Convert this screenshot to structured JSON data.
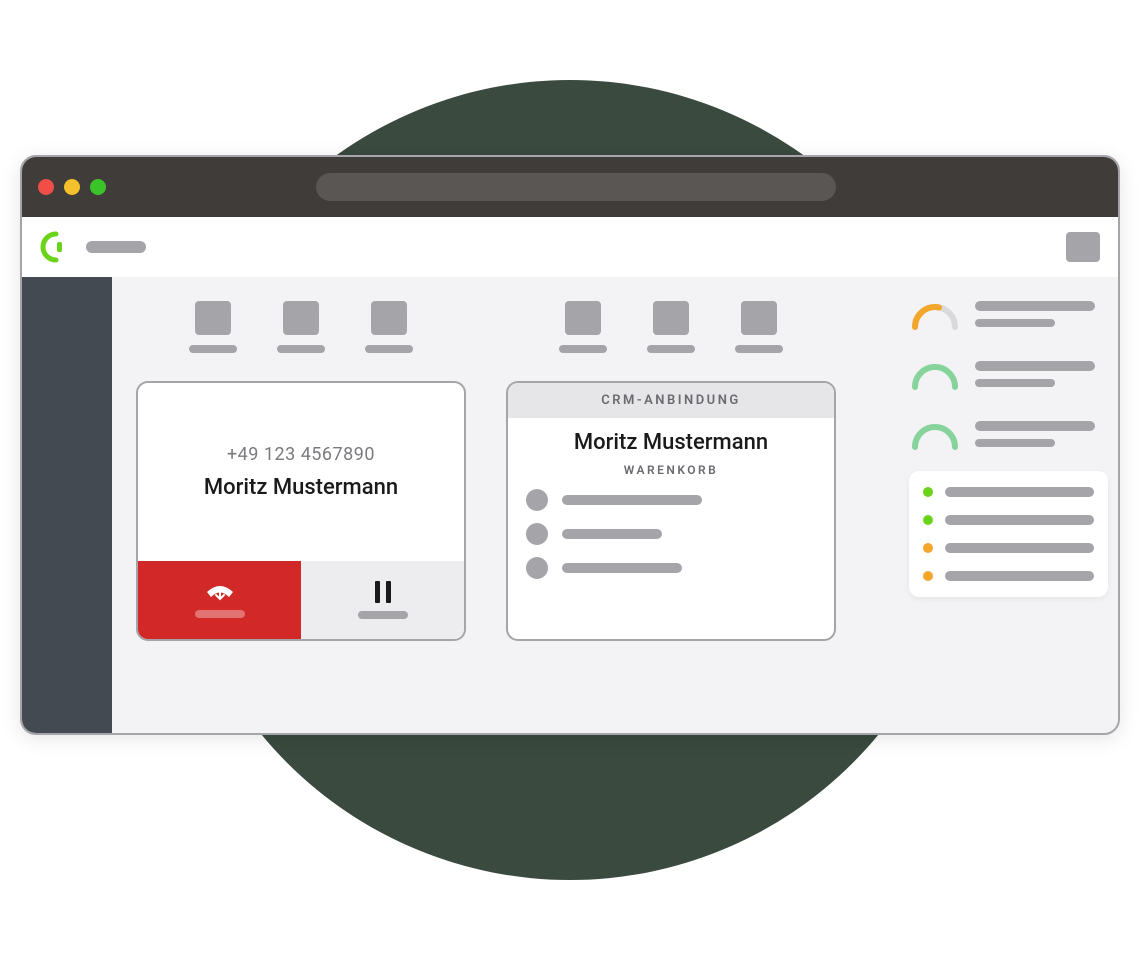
{
  "colors": {
    "bg_circle": "#3a4a3e",
    "titlebar": "#3f3c3a",
    "sidebar": "#444a52",
    "accent_green": "#6ad41a",
    "accent_orange": "#f4a62b",
    "danger": "#d22828",
    "placeholder": "#a5a5a9",
    "logo_green": "#6ad41a"
  },
  "call_card": {
    "phone": "+49 123 4567890",
    "name": "Moritz Mustermann"
  },
  "crm_card": {
    "header": "CRM-ANBINDUNG",
    "name": "Moritz Mustermann",
    "cart_label": "WARENKORB",
    "cart_items": 3
  },
  "gauges": [
    {
      "color": "#f4a62b",
      "progress": 0.55
    },
    {
      "color": "#86d39b",
      "progress": 1.0
    },
    {
      "color": "#86d39b",
      "progress": 1.0
    }
  ],
  "status_list": [
    {
      "status": "green"
    },
    {
      "status": "green"
    },
    {
      "status": "orange"
    },
    {
      "status": "orange"
    }
  ]
}
